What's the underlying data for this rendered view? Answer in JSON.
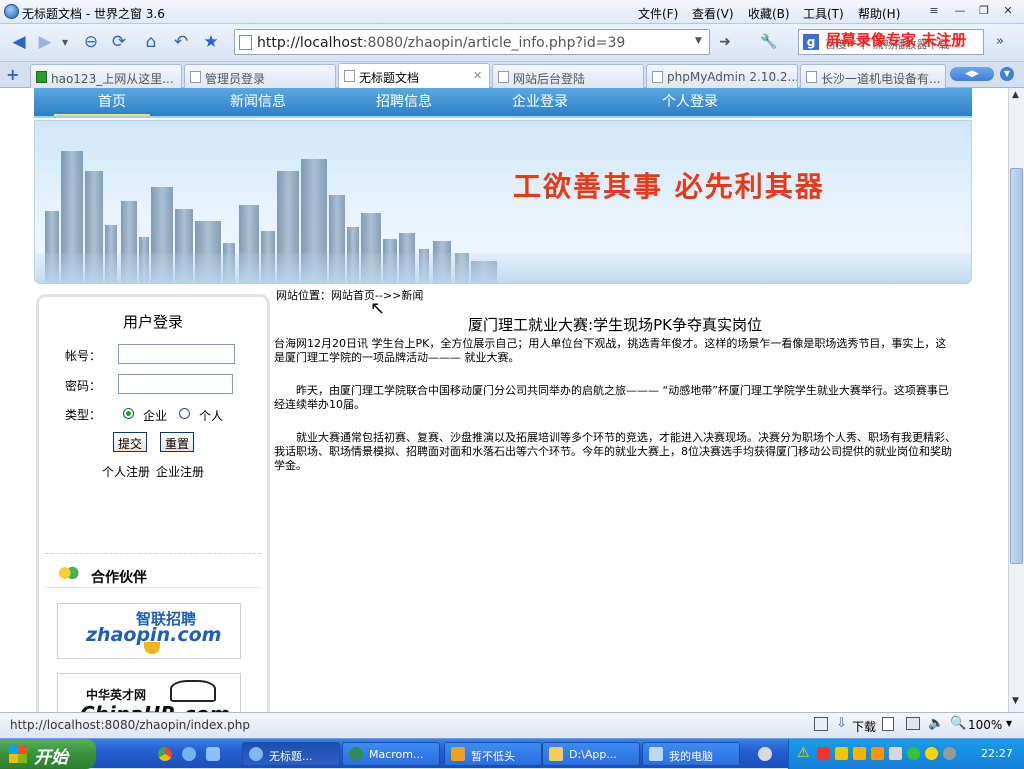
{
  "window": {
    "title": "无标题文档 - 世界之窗 3.6",
    "menu": [
      "文件(F)",
      "查看(V)",
      "收藏(B)",
      "工具(T)",
      "帮助(H)"
    ]
  },
  "address": {
    "url_host": "http://localhost",
    "url_rest": ":8080/zhaopin/article_info.php?id=39",
    "search_placeholder": "百度一下 流畅播放器下载",
    "watermark": "屏幕录像专家 未注册"
  },
  "tabs": [
    {
      "label": "hao123_上网从这里..."
    },
    {
      "label": "管理员登录"
    },
    {
      "label": "无标题文档"
    },
    {
      "label": "网站后台登陆"
    },
    {
      "label": "phpMyAdmin 2.10.2..."
    },
    {
      "label": "长沙一道机电设备有..."
    }
  ],
  "site": {
    "nav": [
      "首页",
      "新闻信息",
      "招聘信息",
      "企业登录",
      "个人登录"
    ],
    "slogan": "工欲善其事 必先利其器",
    "breadcrumb": "网站位置：网站首页-->>新闻"
  },
  "login": {
    "title": "用户登录",
    "account_label": "帐号：",
    "password_label": "密码：",
    "type_label": "类型：",
    "opt_company": "企业",
    "opt_person": "个人",
    "submit": "提交",
    "reset": "重置",
    "reg_person": "个人注册",
    "reg_company": "企业注册"
  },
  "partners": {
    "title": "合作伙伴",
    "logo1_cn": "智联招聘",
    "logo1_en": "zhaopin.com",
    "logo2_cn": "中华英才网",
    "logo2_en": "ChinaHR.com"
  },
  "article": {
    "title": "厦门理工就业大赛:学生现场PK争夺真实岗位",
    "p1": "台海网12月20日讯 学生台上PK，全方位展示自己；用人单位台下观战，挑选青年俊才。这样的场景乍一看像是职场选秀节目，事实上，这是厦门理工学院的一项品牌活动——— 就业大赛。",
    "p2": "昨天，由厦门理工学院联合中国移动厦门分公司共同举办的启航之旅——— “动感地带”杯厦门理工学院学生就业大赛举行。这项赛事已经连续举办10届。",
    "p3": "就业大赛通常包括初赛、复赛、沙盘推演以及拓展培训等多个环节的竞选，才能进入决赛现场。决赛分为职场个人秀、职场有我更精彩、我话职场、职场情景模拟、招聘面对面和水落石出等六个环节。今年的就业大赛上，8位决赛选手均获得厦门移动公司提供的就业岗位和奖助学金。"
  },
  "status": {
    "url": "http://localhost:8080/zhaopin/index.php",
    "download": "下载",
    "zoom": "100%"
  },
  "taskbar": {
    "start": "开始",
    "tasks": [
      "无标题...",
      "Macrom...",
      "暂不低头",
      "D:\\App...",
      "我的电脑"
    ],
    "clock": "22:27"
  },
  "colors": {
    "nav_blue": "#2d7fc6",
    "slogan_red": "#e63b1a",
    "taskbar_blue": "#245fd0"
  }
}
